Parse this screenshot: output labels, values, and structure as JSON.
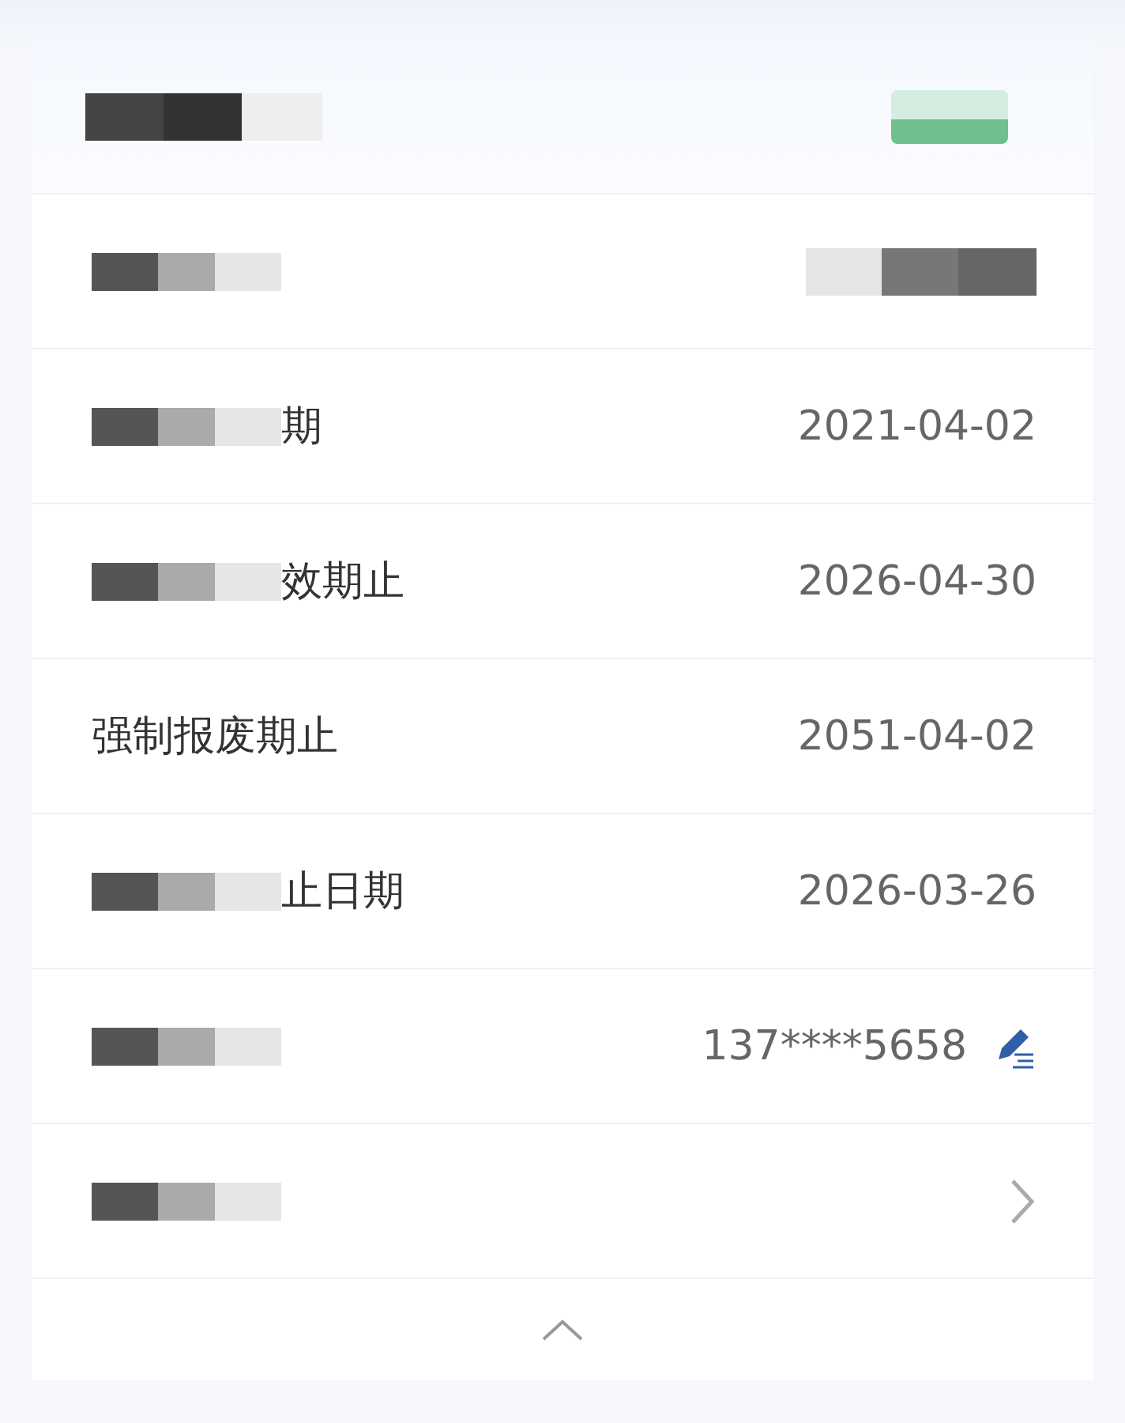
{
  "header": {
    "title": [
      {
        "kind": "redacted"
      }
    ],
    "badge": {
      "kind": "redacted"
    }
  },
  "rows": [
    {
      "kind": "plain",
      "label": [
        {
          "kind": "redacted"
        }
      ],
      "value": [
        {
          "kind": "redacted"
        }
      ]
    },
    {
      "kind": "plain",
      "label": [
        {
          "kind": "redacted"
        },
        {
          "kind": "text",
          "text": "期"
        }
      ],
      "value": [
        {
          "kind": "text",
          "text": "2021-04-02"
        }
      ]
    },
    {
      "kind": "plain",
      "label": [
        {
          "kind": "redacted"
        },
        {
          "kind": "text",
          "text": "效期止"
        }
      ],
      "value": [
        {
          "kind": "text",
          "text": "2026-04-30"
        }
      ]
    },
    {
      "kind": "plain",
      "label": [
        {
          "kind": "text",
          "text": "强制报废期止"
        }
      ],
      "value": [
        {
          "kind": "text",
          "text": "2051-04-02"
        }
      ]
    },
    {
      "kind": "plain",
      "label": [
        {
          "kind": "redacted"
        },
        {
          "kind": "text",
          "text": "止日期"
        }
      ],
      "value": [
        {
          "kind": "text",
          "text": "2026-03-26"
        }
      ]
    },
    {
      "kind": "editable",
      "label": [
        {
          "kind": "redacted"
        }
      ],
      "value": [
        {
          "kind": "text",
          "text": "137****5658"
        }
      ]
    },
    {
      "kind": "link",
      "label": [
        {
          "kind": "redacted"
        }
      ]
    }
  ],
  "footer": {
    "expanded": true
  }
}
